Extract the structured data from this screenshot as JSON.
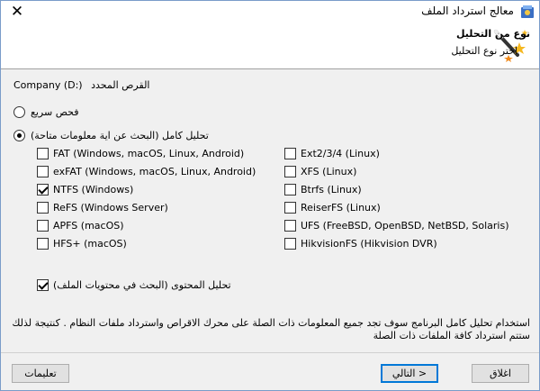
{
  "window": {
    "title": "معالج استرداد الملف",
    "close_glyph": "✕"
  },
  "header": {
    "title": "نوع من التحليل",
    "subtitle": "اختر نوع التحليل"
  },
  "drive": {
    "label": "القرص المحدد",
    "name": "Company (D:)"
  },
  "scan_options": {
    "quick_scan": {
      "label": "فحص سريع",
      "checked": false
    },
    "full_scan": {
      "label": "تحليل كامل (البحث عن اية معلومات متاحة)",
      "checked": true
    }
  },
  "filesystems_left": [
    {
      "label": "FAT (Windows, macOS, Linux, Android)",
      "checked": false
    },
    {
      "label": "exFAT (Windows, macOS, Linux, Android)",
      "checked": false
    },
    {
      "label": "NTFS (Windows)",
      "checked": true
    },
    {
      "label": "ReFS (Windows Server)",
      "checked": false
    },
    {
      "label": "APFS (macOS)",
      "checked": false
    },
    {
      "label": "HFS+ (macOS)",
      "checked": false
    }
  ],
  "filesystems_right": [
    {
      "label": "Ext2/3/4 (Linux)",
      "checked": false
    },
    {
      "label": "XFS (Linux)",
      "checked": false
    },
    {
      "label": "Btrfs (Linux)",
      "checked": false
    },
    {
      "label": "ReiserFS (Linux)",
      "checked": false
    },
    {
      "label": "UFS (FreeBSD, OpenBSD, NetBSD, Solaris)",
      "checked": false
    },
    {
      "label": "HikvisionFS (Hikvision DVR)",
      "checked": false
    }
  ],
  "content_analysis": {
    "label": "تحليل المحتوى (البحث في محتويات الملف)",
    "checked": true
  },
  "description": "استخدام تحليل كامل البرنامج سوف تجد جميع المعلومات ذات الصلة على محرك الاقراص واسترداد ملفات النظام . كنتيجة لذلك ستتم استرداد كافة الملفات ذات الصلة",
  "buttons": {
    "help": "تعليمات",
    "next": "التالي >",
    "close": "اغلاق"
  }
}
